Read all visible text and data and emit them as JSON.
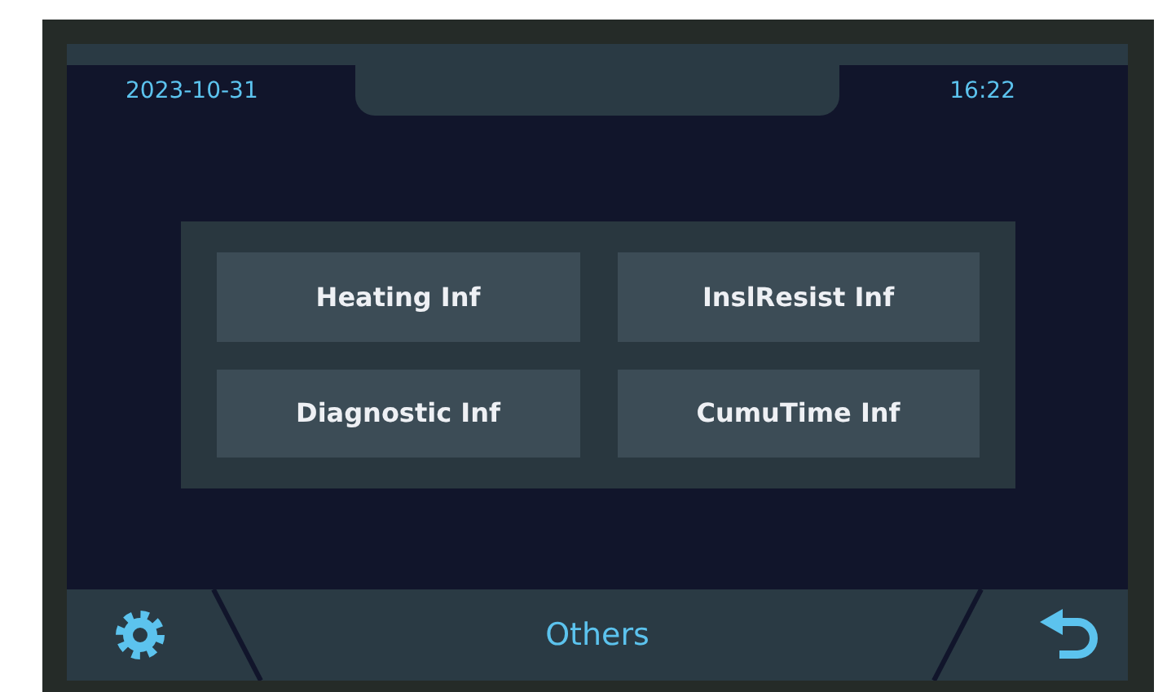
{
  "header": {
    "date": "2023-10-31",
    "time": "16:22"
  },
  "menu": [
    {
      "label": "Heating Inf"
    },
    {
      "label": "InslResist Inf"
    },
    {
      "label": "Diagnostic Inf"
    },
    {
      "label": "CumuTime Inf"
    }
  ],
  "footer": {
    "title": "Others"
  }
}
